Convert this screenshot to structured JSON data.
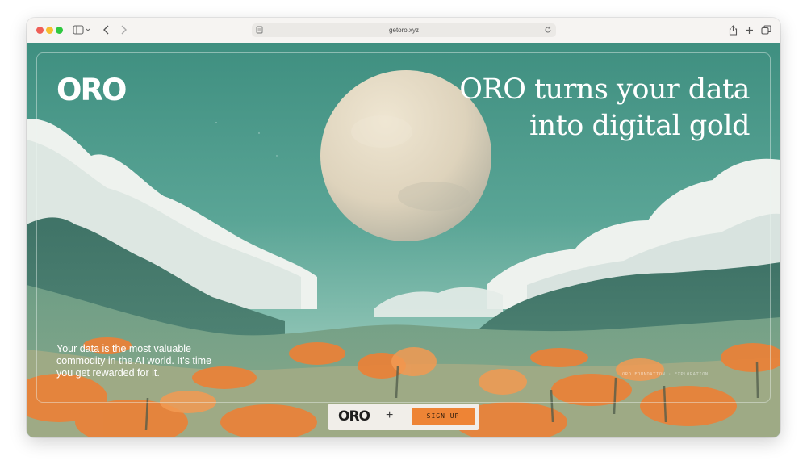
{
  "browser": {
    "url": "getoro.xyz"
  },
  "page": {
    "logo": "ORO",
    "headline_line1": "ORO turns your data",
    "headline_line2": "into digital gold",
    "tagline": "Your data is the most valuable commodity in the AI world. It's time you get rewarded for it.",
    "credits": "ORO FOUNDATION · EXPLORATION",
    "signup": {
      "logo": "ORO",
      "plus": "+",
      "button_label": "SIGN UP"
    }
  },
  "colors": {
    "sky": "#4f9c8e",
    "accent_orange": "#ee8435",
    "pill_background": "#f1eee9"
  }
}
